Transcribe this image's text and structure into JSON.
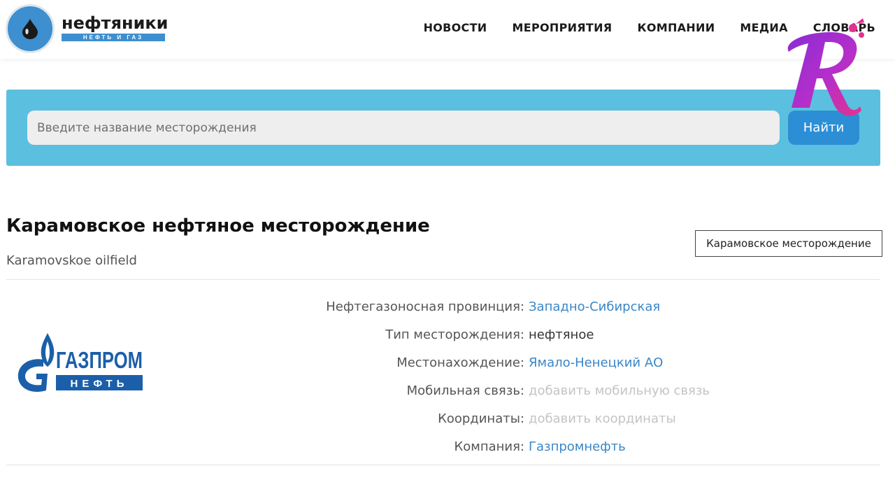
{
  "header": {
    "logo": {
      "title": "нефтяники",
      "subtitle": "НЕФТЬ И ГАЗ"
    },
    "nav": [
      {
        "label": "НОВОСТИ"
      },
      {
        "label": "МЕРОПРИЯТИЯ"
      },
      {
        "label": "КОМПАНИИ"
      },
      {
        "label": "МЕДИА"
      },
      {
        "label": "СЛОВАРЬ"
      }
    ]
  },
  "search": {
    "placeholder": "Введите название месторождения",
    "value": "",
    "button_label": "Найти"
  },
  "field": {
    "title": "Карамовское нефтяное месторождение",
    "subtitle": "Karamovskoe oilfield",
    "tag": "Карамовское месторождение",
    "company_logo": {
      "line1": "ГАЗПРОМ",
      "line2": "НЕФТЬ"
    },
    "info": [
      {
        "label": "Нефтегазоносная провинция:",
        "value": "Западно-Сибирская",
        "style": "link"
      },
      {
        "label": "Тип месторождения:",
        "value": "нефтяное",
        "style": "plain"
      },
      {
        "label": "Местонахождение:",
        "value": "Ямало-Ненецкий АО",
        "style": "link"
      },
      {
        "label": "Мобильная связь:",
        "value": "добавить мобильную связь",
        "style": "muted"
      },
      {
        "label": "Координаты:",
        "value": "добавить координаты",
        "style": "muted"
      },
      {
        "label": "Компания:",
        "value": "Газпромнефть",
        "style": "link"
      }
    ]
  },
  "colors": {
    "accent_blue": "#3d8fcf",
    "search_band": "#5bbfe0",
    "search_button": "#2c8fd5",
    "link": "#3a86c8",
    "gazprom_blue": "#1b5faa"
  },
  "icons": {
    "logo": "oil-drop-icon",
    "overlay": "r-badge-icon"
  }
}
